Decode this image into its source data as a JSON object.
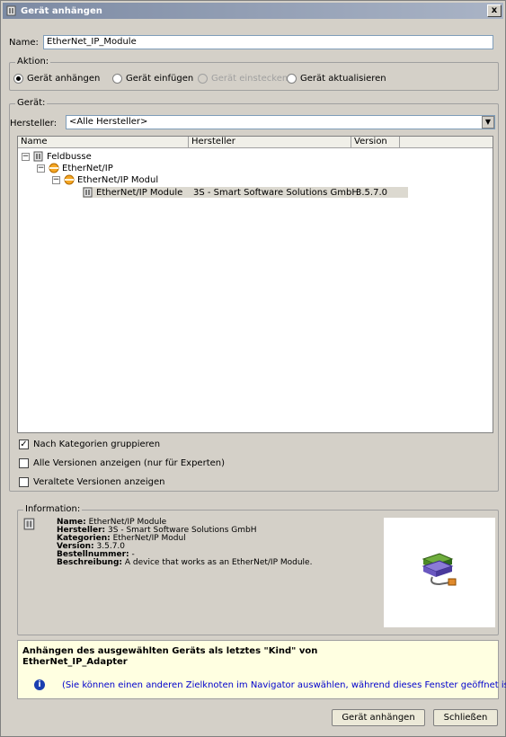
{
  "window": {
    "title": "Gerät anhängen",
    "close_label": "x"
  },
  "name": {
    "label": "Name:",
    "value": "EtherNet_IP_Module"
  },
  "action": {
    "legend": "Aktion:",
    "options": [
      {
        "label": "Gerät anhängen",
        "selected": true,
        "enabled": true
      },
      {
        "label": "Gerät einfügen",
        "selected": false,
        "enabled": true
      },
      {
        "label": "Gerät einstecken",
        "selected": false,
        "enabled": false
      },
      {
        "label": "Gerät aktualisieren",
        "selected": false,
        "enabled": true
      }
    ]
  },
  "device": {
    "legend": "Gerät:",
    "manufacturer_label": "Hersteller:",
    "manufacturer_value": "<Alle Hersteller>",
    "columns": [
      "Name",
      "Hersteller",
      "Version"
    ],
    "tree": [
      {
        "name": "Feldbusse",
        "level": 0,
        "expander": "−",
        "icon": "device-icon"
      },
      {
        "name": "EtherNet/IP",
        "level": 1,
        "expander": "−",
        "icon": "network-icon"
      },
      {
        "name": "EtherNet/IP Modul",
        "level": 2,
        "expander": "−",
        "icon": "network-icon"
      },
      {
        "name": "EtherNet/IP Module",
        "level": 3,
        "expander": "",
        "icon": "device-icon",
        "manufacturer": "3S - Smart Software Solutions GmbH",
        "version": "3.5.7.0",
        "selected": true
      }
    ],
    "checkboxes": [
      {
        "label": "Nach Kategorien gruppieren",
        "checked": true
      },
      {
        "label": "Alle Versionen anzeigen (nur für Experten)",
        "checked": false
      },
      {
        "label": "Veraltete Versionen anzeigen",
        "checked": false
      }
    ]
  },
  "information": {
    "legend": "Information:",
    "rows": [
      {
        "key": "Name:",
        "value": "EtherNet/IP Module"
      },
      {
        "key": "Hersteller:",
        "value": "3S - Smart Software Solutions GmbH"
      },
      {
        "key": "Kategorien:",
        "value": "EtherNet/IP Modul"
      },
      {
        "key": "Version:",
        "value": "3.5.7.0"
      },
      {
        "key": "Bestellnummer:",
        "value": "-"
      },
      {
        "key": "Beschreibung:",
        "value": "A device that works as an EtherNet/IP Module."
      }
    ]
  },
  "hint": {
    "title_line1": "Anhängen des ausgewählten Geräts als letztes \"Kind\" von",
    "title_line2": "EtherNet_IP_Adapter",
    "note": "(Sie können einen anderen Zielknoten im Navigator auswählen, während dieses Fenster geöffnet ist.)"
  },
  "buttons": {
    "attach": "Gerät anhängen",
    "close": "Schließen"
  },
  "colors": {
    "hint_background": "#ffffe1",
    "note_text": "#0000cc",
    "selection": "#dcd9d0"
  }
}
